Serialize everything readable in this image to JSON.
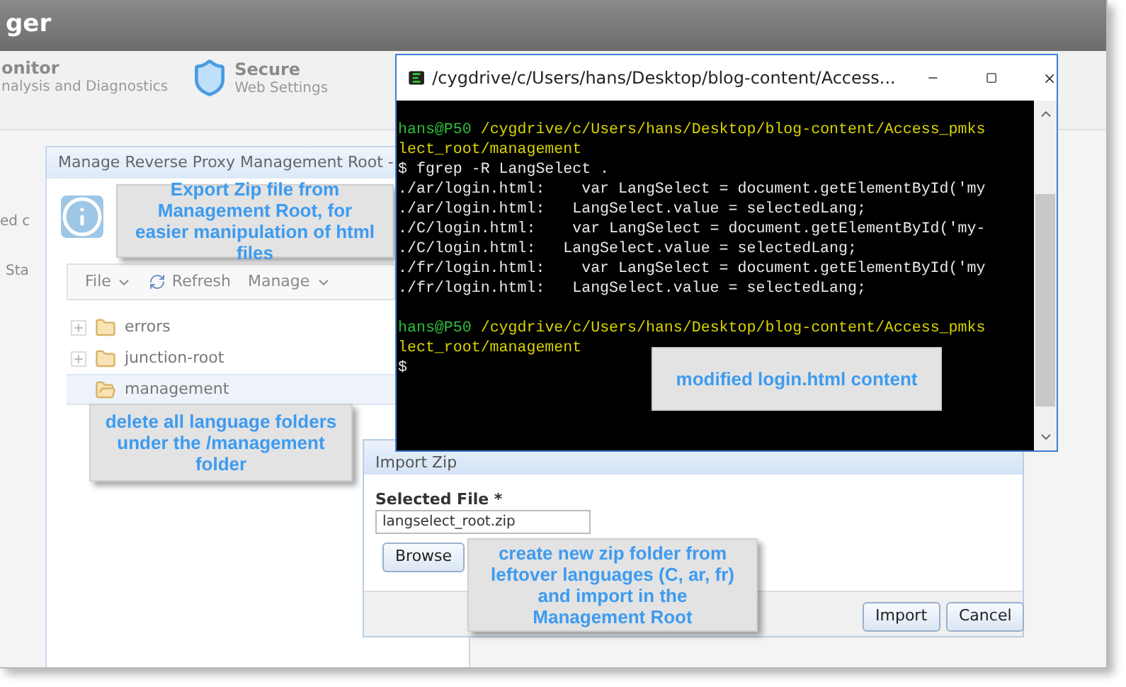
{
  "app_title": "ger",
  "nav": [
    {
      "title": "onitor",
      "subtitle": "nalysis and Diagnostics",
      "icon": false
    },
    {
      "title": "Secure",
      "subtitle": "Web Settings",
      "icon": true
    }
  ],
  "side_texts": [
    "ed c",
    "Sta"
  ],
  "manage_dialog": {
    "title": "Manage Reverse Proxy Management Root -",
    "note": "Export Zip file from Management Root, for easier manipulation of html files",
    "toolbar": [
      {
        "label": "File",
        "kind": "menu"
      },
      {
        "label": "Refresh",
        "kind": "button"
      },
      {
        "label": "Manage",
        "kind": "menu"
      }
    ],
    "tree": [
      {
        "name": "errors",
        "expanded": false,
        "selected": false
      },
      {
        "name": "junction-root",
        "expanded": false,
        "selected": false
      },
      {
        "name": "management",
        "expanded": true,
        "selected": true
      }
    ],
    "tree_note": "delete all language folders under the /management folder"
  },
  "terminal": {
    "title": "/cygdrive/c/Users/hans/Desktop/blog-content/Access...",
    "lines": [
      {
        "kind": "blank"
      },
      {
        "kind": "prompt",
        "user": "hans@P50",
        "text": "/cygdrive/c/Users/hans/Desktop/blog-content/Access_pmks"
      },
      {
        "kind": "path",
        "text": "lect_root/management"
      },
      {
        "kind": "output",
        "text": "$ fgrep -R LangSelect ."
      },
      {
        "kind": "output",
        "text": "./ar/login.html:    var LangSelect = document.getElementById('my"
      },
      {
        "kind": "output",
        "text": "./ar/login.html:   LangSelect.value = selectedLang;"
      },
      {
        "kind": "output",
        "text": "./C/login.html:    var LangSelect = document.getElementById('my-"
      },
      {
        "kind": "output",
        "text": "./C/login.html:   LangSelect.value = selectedLang;"
      },
      {
        "kind": "output",
        "text": "./fr/login.html:    var LangSelect = document.getElementById('my"
      },
      {
        "kind": "output",
        "text": "./fr/login.html:   LangSelect.value = selectedLang;"
      },
      {
        "kind": "blank"
      },
      {
        "kind": "prompt",
        "user": "hans@P50",
        "text": "/cygdrive/c/Users/hans/Desktop/blog-content/Access_pmks"
      },
      {
        "kind": "path",
        "text": "lect_root/management"
      },
      {
        "kind": "output",
        "text": "$"
      }
    ],
    "note": "modified login.html content"
  },
  "import_dialog": {
    "title": "Import Zip",
    "field_label": "Selected File *",
    "field_value": "langselect_root.zip",
    "browse": "Browse",
    "buttons": [
      "Import",
      "Cancel"
    ],
    "note": "create new zip folder from leftover languages (C, ar, fr) and import in the Management Root"
  }
}
